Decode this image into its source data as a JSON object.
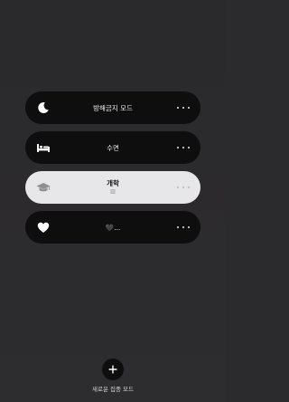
{
  "focus_modes": [
    {
      "label": "방해금지 모드",
      "sub": "",
      "icon": "moon-icon",
      "active": false
    },
    {
      "label": "수면",
      "sub": "",
      "icon": "bed-icon",
      "active": false
    },
    {
      "label": "개학",
      "sub": "▥",
      "icon": "graduation-cap-icon",
      "active": true
    },
    {
      "label": "🖤...",
      "sub": "",
      "icon": "heart-icon",
      "active": false
    }
  ],
  "add_mode": {
    "icon": "plus-icon",
    "label": "새로운 집중 모드"
  },
  "colors": {
    "background": "#2b2a2c",
    "pill": "#0e0e0f",
    "pill_active": "#e7e6e8"
  }
}
